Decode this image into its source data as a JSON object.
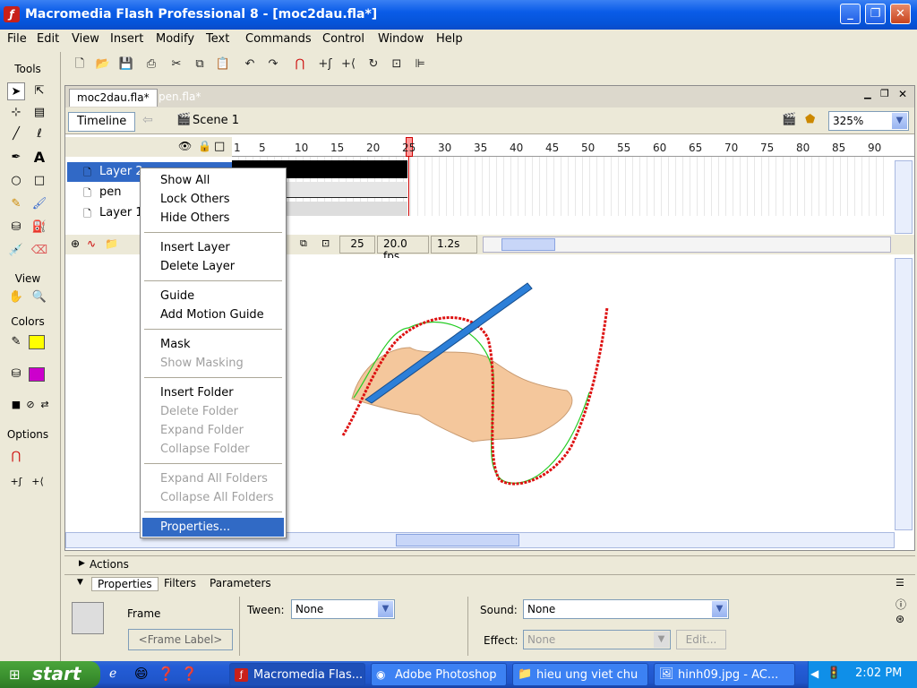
{
  "app": {
    "title": "Macromedia Flash Professional 8 - [moc2dau.fla*]",
    "icon_letter": "ƒ"
  },
  "window_buttons": [
    "_",
    "❐",
    "✕"
  ],
  "menu": [
    "File",
    "Edit",
    "View",
    "Insert",
    "Modify",
    "Text",
    "Commands",
    "Control",
    "Window",
    "Help"
  ],
  "tools": {
    "title": "Tools",
    "view_label": "View",
    "colors_label": "Colors",
    "options_label": "Options"
  },
  "doc_tabs": [
    "moc2dau.fla*",
    "pen.fla*"
  ],
  "timeline": {
    "timeline_button": "Timeline",
    "scene_label": "Scene 1",
    "zoom": "325%",
    "ruler": [
      "1",
      "5",
      "10",
      "15",
      "20",
      "25",
      "30",
      "35",
      "40",
      "45",
      "50",
      "55",
      "60",
      "65",
      "70",
      "75",
      "80",
      "85",
      "90"
    ],
    "layers": [
      "Layer 2",
      "pen",
      "Layer 1"
    ],
    "current_frame": "25",
    "fps": "20.0 fps",
    "time": "1.2s"
  },
  "context_menu": [
    {
      "label": "Show All",
      "state": "normal"
    },
    {
      "label": "Lock Others",
      "state": "normal"
    },
    {
      "label": "Hide Others",
      "state": "normal"
    },
    {
      "label": "Insert Layer",
      "state": "normal"
    },
    {
      "label": "Delete Layer",
      "state": "normal"
    },
    {
      "label": "Guide",
      "state": "normal"
    },
    {
      "label": "Add Motion Guide",
      "state": "normal"
    },
    {
      "label": "Mask",
      "state": "normal"
    },
    {
      "label": "Show Masking",
      "state": "disabled"
    },
    {
      "label": "Insert Folder",
      "state": "normal"
    },
    {
      "label": "Delete Folder",
      "state": "disabled"
    },
    {
      "label": "Expand Folder",
      "state": "disabled"
    },
    {
      "label": "Collapse Folder",
      "state": "disabled"
    },
    {
      "label": "Expand All Folders",
      "state": "disabled"
    },
    {
      "label": "Collapse All Folders",
      "state": "disabled"
    },
    {
      "label": "Properties...",
      "state": "highlighted"
    }
  ],
  "panels": {
    "actions": "Actions",
    "tabs": [
      "Properties",
      "Filters",
      "Parameters"
    ],
    "frame_label": "Frame",
    "frame_label_placeholder": "<Frame Label>",
    "tween_label": "Tween:",
    "tween_value": "None",
    "sound_label": "Sound:",
    "sound_value": "None",
    "effect_label": "Effect:",
    "effect_value": "None",
    "edit_button": "Edit..."
  },
  "taskbar": {
    "start": "start",
    "tasks": [
      "Macromedia Flas...",
      "Adobe Photoshop",
      "hieu ung viet chu",
      "hinh09.jpg - AC..."
    ],
    "clock": "2:02 PM"
  },
  "colors": {
    "stroke": "#ffff00",
    "fill": "#cc00cc",
    "selection": "#3169c6",
    "titlebar": "#0553d8"
  }
}
